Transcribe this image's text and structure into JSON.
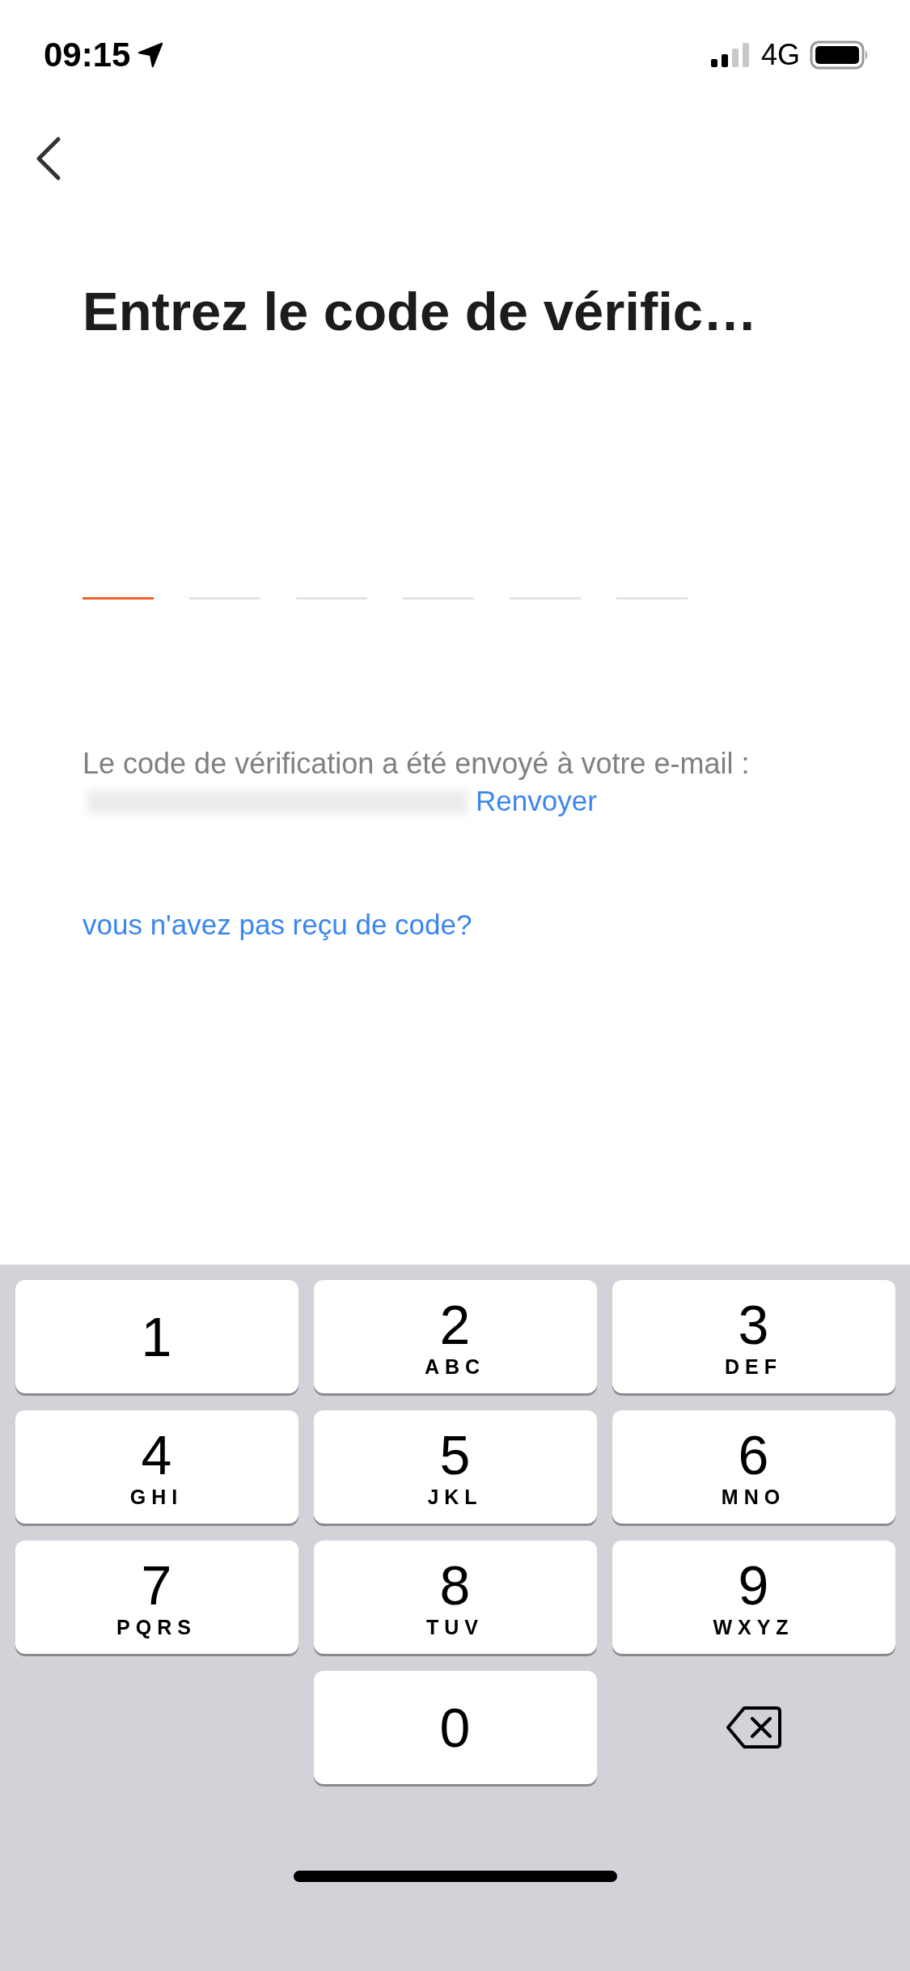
{
  "status_bar": {
    "time": "09:15",
    "network": "4G"
  },
  "title": "Entrez le code de vérific…",
  "code_slots": [
    {
      "selected": true
    },
    {
      "selected": false
    },
    {
      "selected": false
    },
    {
      "selected": false
    },
    {
      "selected": false
    },
    {
      "selected": false
    }
  ],
  "message": {
    "text": "Le code de vérification a été envoyé à votre e-mail :",
    "email_redacted": true,
    "resend_link": "Renvoyer"
  },
  "help_link": "vous n'avez pas reçu de code?",
  "keypad": {
    "rows": [
      [
        {
          "kind": "digit",
          "digit": "1"
        },
        {
          "kind": "digit",
          "digit": "2",
          "letters": "ABC"
        },
        {
          "kind": "digit",
          "digit": "3",
          "letters": "DEF"
        }
      ],
      [
        {
          "kind": "digit",
          "digit": "4",
          "letters": "GHI"
        },
        {
          "kind": "digit",
          "digit": "5",
          "letters": "JKL"
        },
        {
          "kind": "digit",
          "digit": "6",
          "letters": "MNO"
        }
      ],
      [
        {
          "kind": "digit",
          "digit": "7",
          "letters": "PQRS"
        },
        {
          "kind": "digit",
          "digit": "8",
          "letters": "TUV"
        },
        {
          "kind": "digit",
          "digit": "9",
          "letters": "WXYZ"
        }
      ],
      [
        {
          "kind": "spacer"
        },
        {
          "kind": "digit",
          "digit": "0"
        },
        {
          "kind": "delete"
        }
      ]
    ]
  }
}
